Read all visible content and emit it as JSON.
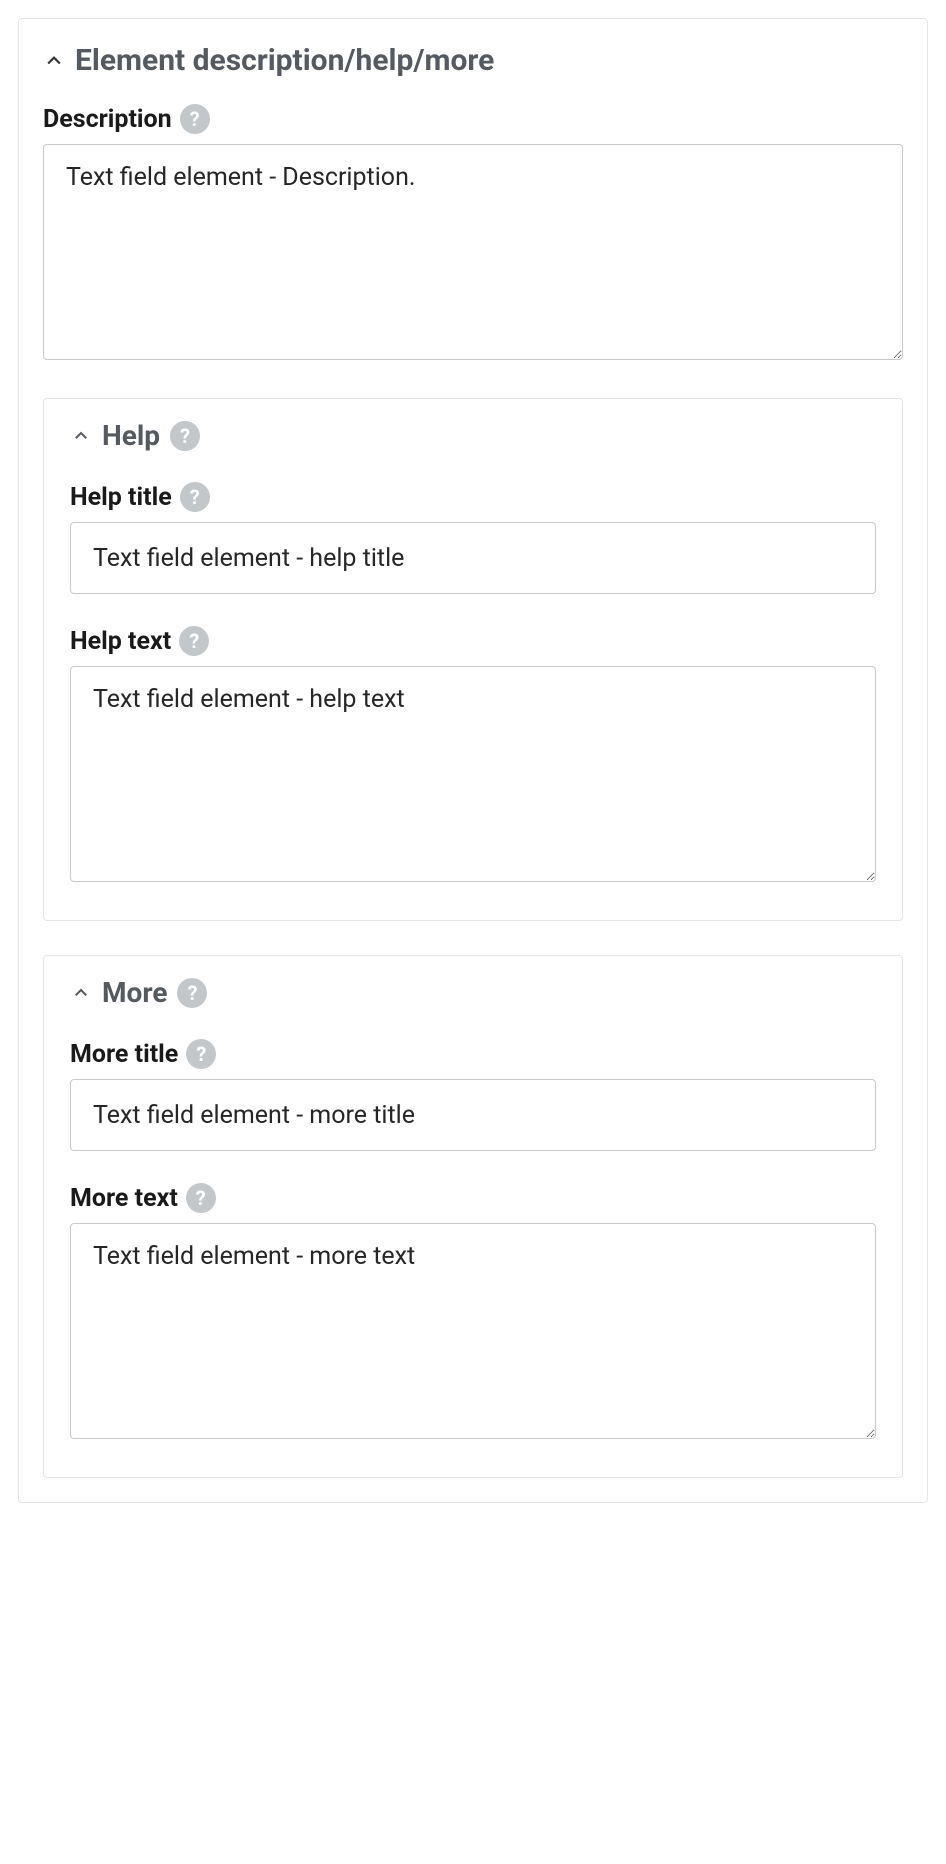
{
  "section": {
    "title": "Element description/help/more"
  },
  "description": {
    "label": "Description",
    "value": "Text field element - Description."
  },
  "help": {
    "title": "Help",
    "helpTitle": {
      "label": "Help title",
      "value": "Text field element - help title"
    },
    "helpText": {
      "label": "Help text",
      "value": "Text field element - help text"
    }
  },
  "more": {
    "title": "More",
    "moreTitle": {
      "label": "More title",
      "value": "Text field element - more title"
    },
    "moreText": {
      "label": "More text",
      "value": "Text field element - more text"
    }
  },
  "helpGlyph": "?"
}
